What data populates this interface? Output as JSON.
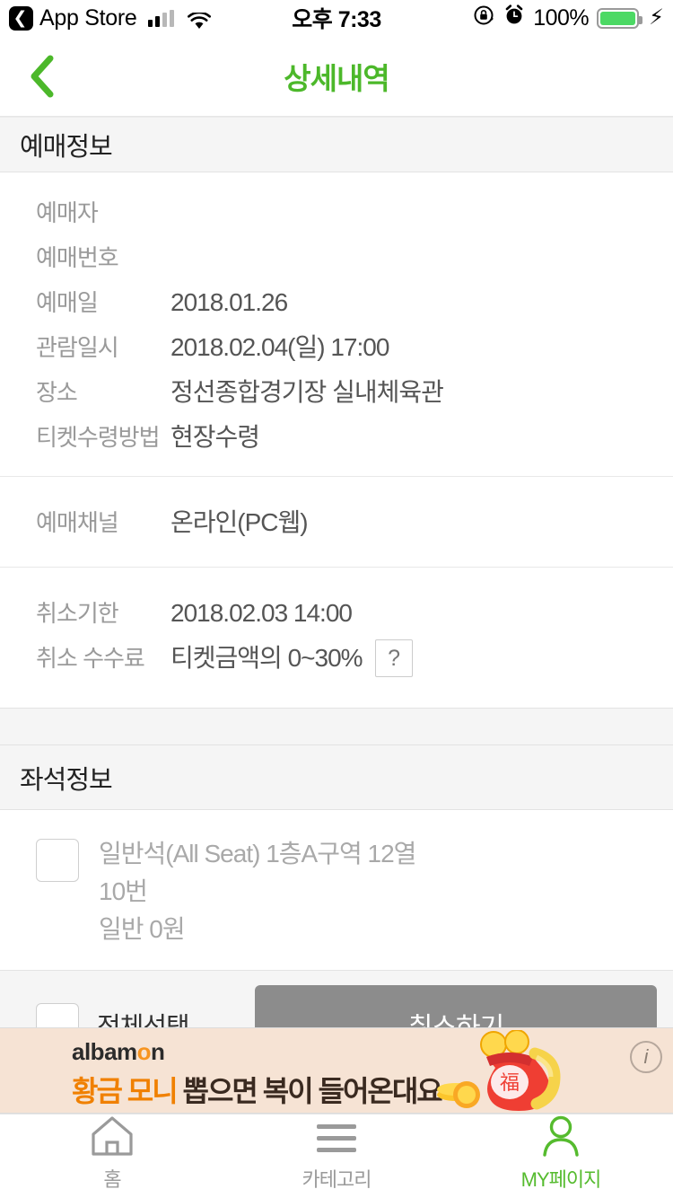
{
  "colors": {
    "accent": "#55bb2e",
    "button_gray": "#8c8c8c",
    "ad_bg": "#f6e3d4",
    "battery_green": "#4cd964"
  },
  "status_bar": {
    "back_app": "App Store",
    "time": "오후 7:33",
    "battery_percent": "100%",
    "icons": [
      "signal-bars-icon",
      "wifi-icon",
      "rotation-lock-icon",
      "alarm-clock-icon",
      "battery-icon",
      "charging-bolt-icon"
    ]
  },
  "nav": {
    "title": "상세내역",
    "back_icon": "chevron-left-icon"
  },
  "booking_section": {
    "title": "예매정보",
    "group1": [
      {
        "label": "예매자",
        "value": ""
      },
      {
        "label": "예매번호",
        "value": ""
      },
      {
        "label": "예매일",
        "value": "2018.01.26"
      },
      {
        "label": "관람일시",
        "value": "2018.02.04(일) 17:00"
      },
      {
        "label": "장소",
        "value": "정선종합경기장 실내체육관"
      },
      {
        "label": "티켓수령방법",
        "value": "현장수령"
      }
    ],
    "group2": [
      {
        "label": "예매채널",
        "value": "온라인(PC웹)"
      }
    ],
    "group3": [
      {
        "label": "취소기한",
        "value": "2018.02.03 14:00"
      },
      {
        "label": "취소 수수료",
        "value": "티켓금액의 0~30%",
        "help": "?"
      }
    ]
  },
  "seat_section": {
    "title": "좌석정보",
    "items": [
      {
        "line1": "일반석(All Seat) 1층A구역 12열",
        "line2": "10번",
        "line3": "일반 0원"
      }
    ]
  },
  "action_bar": {
    "select_all_label": "전체선택",
    "cancel_button": "취소하기"
  },
  "ad": {
    "brand_pre": "albam",
    "brand_o": "o",
    "brand_post": "n",
    "copy_highlight": "황금 모니",
    "copy_rest": " 뽑으면 복이 들어온대요",
    "fortune_char": "福",
    "info_icon": "info-icon"
  },
  "tabbar": {
    "items": [
      {
        "label": "홈",
        "icon": "home-icon",
        "active": false
      },
      {
        "label": "카테고리",
        "icon": "hamburger-icon",
        "active": false
      },
      {
        "label": "MY페이지",
        "icon": "person-icon",
        "active": true
      }
    ]
  }
}
